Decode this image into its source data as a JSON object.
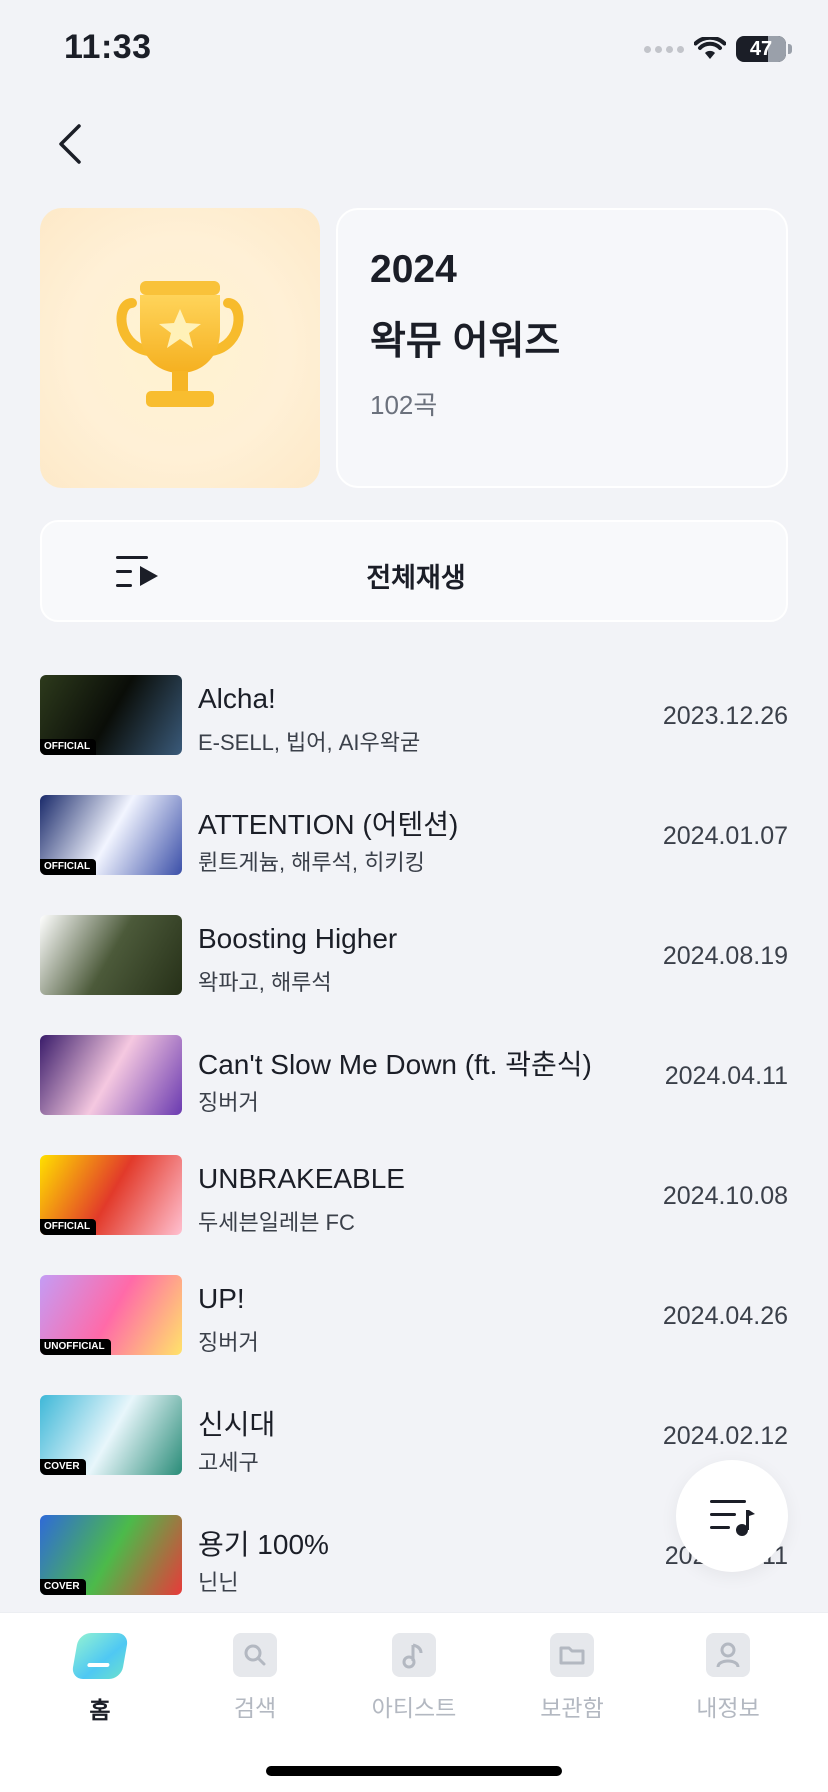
{
  "status": {
    "time": "11:33",
    "battery": "47"
  },
  "playlist": {
    "year": "2024",
    "title": "왁뮤 어워즈",
    "count": "102곡",
    "play_all_label": "전체재생"
  },
  "songs": [
    {
      "title": "Alcha!",
      "artist": "E-SELL, 빕어, AI우왁굳",
      "date": "2023.12.26",
      "badge": "OFFICIAL",
      "thumb_colors": [
        "#2d3a1c",
        "#0a0d08",
        "#3a5a7a"
      ]
    },
    {
      "title": "ATTENTION (어텐션)",
      "artist": "륀트게늄, 해루석, 히키킹",
      "date": "2024.01.07",
      "badge": "OFFICIAL",
      "thumb_colors": [
        "#1a2a6a",
        "#f2f5ff",
        "#3b4fa8"
      ]
    },
    {
      "title": "Boosting Higher",
      "artist": "왁파고, 해루석",
      "date": "2024.08.19",
      "badge": "",
      "thumb_colors": [
        "#ffffff",
        "#4c5a3a",
        "#263018"
      ]
    },
    {
      "title": "Can't Slow Me Down (ft. 곽춘식)",
      "artist": "징버거",
      "date": "2024.04.11",
      "badge": "",
      "thumb_colors": [
        "#3a1c6a",
        "#f5c8e0",
        "#6a3ab0"
      ]
    },
    {
      "title": "UNBRAKEABLE",
      "artist": "두세븐일레븐 FC",
      "date": "2024.10.08",
      "badge": "OFFICIAL",
      "thumb_colors": [
        "#ffe000",
        "#e23a2a",
        "#ffc0d0"
      ]
    },
    {
      "title": "UP!",
      "artist": "징버거",
      "date": "2024.04.26",
      "badge": "UNOFFICIAL",
      "thumb_colors": [
        "#c49cf5",
        "#ff6aa8",
        "#ffe36a"
      ]
    },
    {
      "title": "신시대",
      "artist": "고세구",
      "date": "2024.02.12",
      "badge": "COVER",
      "thumb_colors": [
        "#3fb8d8",
        "#e8f6fb",
        "#2a8c78"
      ]
    },
    {
      "title": "용기 100%",
      "artist": "닌닌",
      "date": "2024.04.11",
      "badge": "COVER",
      "thumb_colors": [
        "#2f6ad8",
        "#4cba4a",
        "#e83a3a"
      ]
    }
  ],
  "tabs": [
    {
      "label": "홈",
      "icon": "home-icon",
      "active": true
    },
    {
      "label": "검색",
      "icon": "search-icon",
      "active": false
    },
    {
      "label": "아티스트",
      "icon": "music-note-icon",
      "active": false
    },
    {
      "label": "보관함",
      "icon": "folder-icon",
      "active": false
    },
    {
      "label": "내정보",
      "icon": "profile-icon",
      "active": false
    }
  ]
}
